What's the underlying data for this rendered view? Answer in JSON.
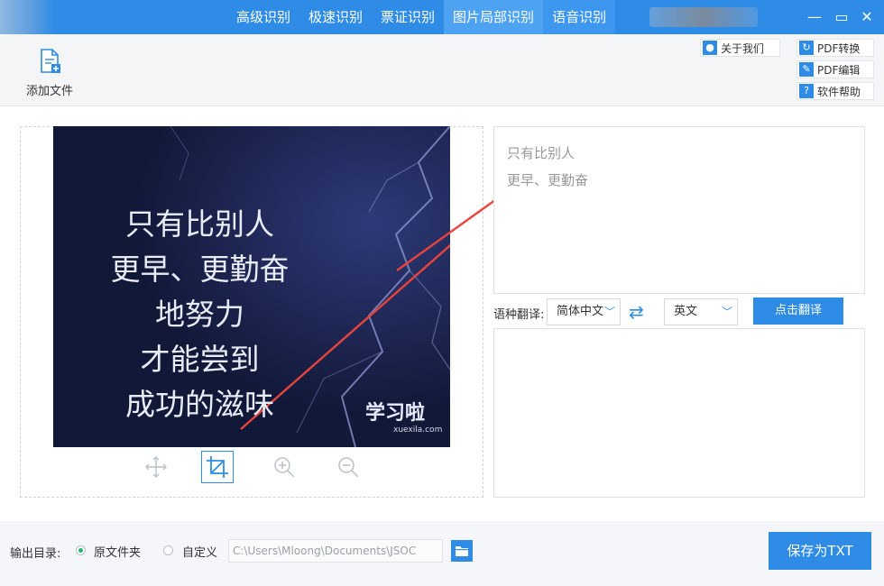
{
  "titlebar": {
    "tabs": [
      {
        "label": "高级识别"
      },
      {
        "label": "极速识别"
      },
      {
        "label": "票证识别"
      },
      {
        "label": "图片局部识别"
      },
      {
        "label": "语音识别"
      }
    ],
    "minimize": "—",
    "maximize": "▭",
    "close": "✕"
  },
  "toolbar": {
    "add_file": "添加文件",
    "about": "关于我们",
    "pdf_convert": "PDF转换",
    "pdf_edit": "PDF编辑",
    "help": "软件帮助"
  },
  "preview": {
    "lines": [
      "只有比别人",
      "更早、更勤奋",
      "地努力",
      "才能尝到",
      "成功的滋味"
    ],
    "watermark": "学习啦",
    "watermark_url": "xuexila.com"
  },
  "ocr_result": {
    "lines": [
      "只有比别人",
      "更早、更勤奋"
    ]
  },
  "translate": {
    "label": "语种翻译:",
    "source_lang": "简体中文",
    "target_lang": "英文",
    "button": "点击翻译"
  },
  "output": {
    "label": "输出目录:",
    "option_original": "原文件夹",
    "option_custom": "自定义",
    "path": "C:\\Users\\Mloong\\Documents\\JSOC",
    "save_button": "保存为TXT"
  },
  "colors": {
    "accent": "#2f8ce6",
    "radio_on": "#22b573",
    "arrow": "#e8443c"
  }
}
